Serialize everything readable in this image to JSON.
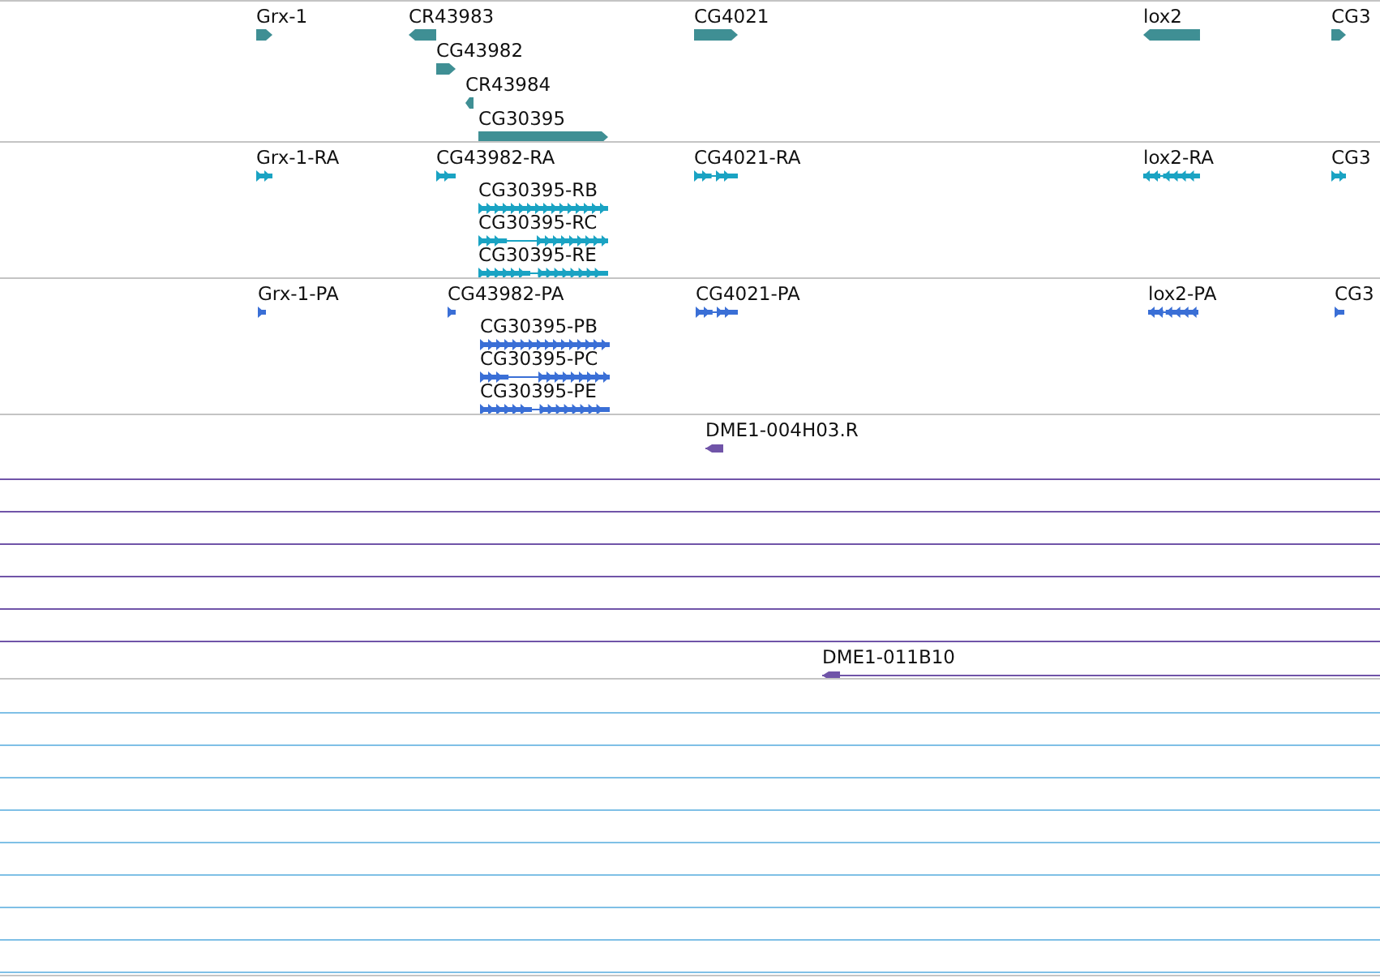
{
  "tracks": [
    {
      "kind": "gene",
      "color": "#3f8f94",
      "features": [
        {
          "label": "Grx-1",
          "reverse": false
        },
        {
          "label": "CR43983",
          "reverse": true
        },
        {
          "label": "CG43982",
          "reverse": false
        },
        {
          "label": "CR43984",
          "reverse": true
        },
        {
          "label": "CG30395",
          "reverse": false
        },
        {
          "label": "CG4021",
          "reverse": false
        },
        {
          "label": "lox2",
          "reverse": true
        },
        {
          "label": "CG3",
          "reverse": false
        }
      ]
    },
    {
      "kind": "transcript",
      "color": "#1aa3c3",
      "features": [
        {
          "label": "Grx-1-RA",
          "reverse": false
        },
        {
          "label": "CG43982-RA",
          "reverse": false
        },
        {
          "label": "CG30395-RB",
          "reverse": false
        },
        {
          "label": "CG30395-RC",
          "reverse": false
        },
        {
          "label": "CG30395-RE",
          "reverse": false
        },
        {
          "label": "CG4021-RA",
          "reverse": false
        },
        {
          "label": "lox2-RA",
          "reverse": true
        },
        {
          "label": "CG3",
          "reverse": false
        }
      ]
    },
    {
      "kind": "transcript",
      "color": "#3a6fd6",
      "features": [
        {
          "label": "Grx-1-PA",
          "reverse": false
        },
        {
          "label": "CG43982-PA",
          "reverse": false
        },
        {
          "label": "CG30395-PB",
          "reverse": false
        },
        {
          "label": "CG30395-PC",
          "reverse": false
        },
        {
          "label": "CG30395-PE",
          "reverse": false
        },
        {
          "label": "CG4021-PA",
          "reverse": false
        },
        {
          "label": "lox2-PA",
          "reverse": true
        },
        {
          "label": "CG3",
          "reverse": false
        }
      ]
    },
    {
      "kind": "clone",
      "color": "#7054a8",
      "features": [
        {
          "label": "DME1-004H03.R",
          "reverse": true
        },
        {
          "label": "DME1-011B10",
          "reverse": true
        }
      ]
    },
    {
      "kind": "clone",
      "color": "#7fc0e6"
    }
  ]
}
